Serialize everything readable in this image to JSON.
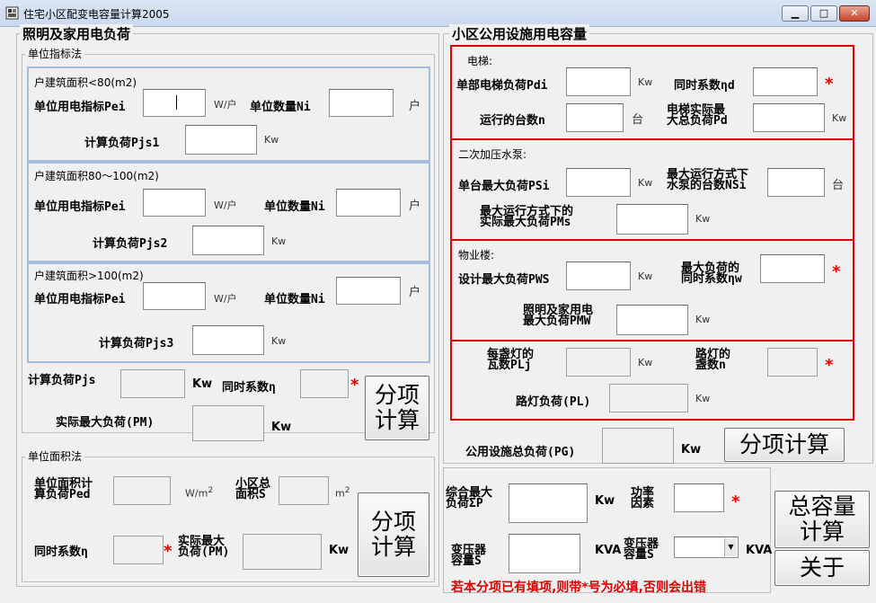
{
  "window": {
    "title": "住宅小区配变电容量计算2005",
    "min": "▁",
    "max": "□",
    "close": "✕"
  },
  "left": {
    "title": "照明及家用电负荷",
    "unit_index_method": {
      "legend": "单位指标法",
      "g1": {
        "legend": "户建筑面积<80(m2)",
        "pei_label": "单位用电指标Pei",
        "pei_unit": "W/户",
        "ni_label": "单位数量Ni",
        "ni_unit": "户",
        "pjs_label": "计算负荷Pjs1",
        "pjs_unit": "Kw"
      },
      "g2": {
        "legend": "户建筑面积80～100(m2)",
        "pei_label": "单位用电指标Pei",
        "pei_unit": "W/户",
        "ni_label": "单位数量Ni",
        "ni_unit": "户",
        "pjs_label": "计算负荷Pjs2",
        "pjs_unit": "Kw"
      },
      "g3": {
        "legend": "户建筑面积>100(m2)",
        "pei_label": "单位用电指标Pei",
        "pei_unit": "W/户",
        "ni_label": "单位数量Ni",
        "ni_unit": "户",
        "pjs_label": "计算负荷Pjs3",
        "pjs_unit": "Kw"
      },
      "total_pjs_label": "计算负荷Pjs",
      "total_pjs_unit": "Kw",
      "coef_label": "同时系数η",
      "star": "*",
      "pm_label": "实际最大负荷(PM)",
      "pm_unit": "Kw",
      "calc_button": [
        "分项",
        "计算"
      ]
    },
    "unit_area_method": {
      "legend": "单位面积法",
      "ped_label": [
        "单位面积计",
        "算负荷Ped"
      ],
      "ped_unit": "W/m",
      "sup2": "2",
      "s_label": [
        "小区总",
        "面积S"
      ],
      "s_unit": "m",
      "coef_label": "同时系数η",
      "star": "*",
      "pm_label": [
        "实际最大",
        "负荷(PM)"
      ],
      "pm_unit": "Kw",
      "calc_button": [
        "分项",
        "计算"
      ]
    }
  },
  "right": {
    "title": "小区公用设施用电容量",
    "elevator": {
      "legend": "电梯:",
      "pdi_label": "单部电梯负荷Pdi",
      "pdi_unit": "Kw",
      "coef_label": "同时系数ηd",
      "star": "*",
      "n_label": "运行的台数n",
      "n_unit": "台",
      "pd_label": [
        "电梯实际最",
        "大总负荷Pd"
      ],
      "pd_unit": "Kw"
    },
    "pump": {
      "legend": "二次加压水泵:",
      "psi_label": "单台最大负荷PSi",
      "psi_unit": "Kw",
      "nsi_label": [
        "最大运行方式下",
        "水泵的台数NSi"
      ],
      "nsi_unit": "台",
      "pms_label": [
        "最大运行方式下的",
        "实际最大负荷PMs"
      ],
      "pms_unit": "Kw"
    },
    "property": {
      "legend": "物业楼:",
      "pws_label": "设计最大负荷PWS",
      "pws_unit": "Kw",
      "coef_label": [
        "最大负荷的",
        "同时系数ηw"
      ],
      "star": "*",
      "pmw_label": [
        "照明及家用电",
        "最大负荷PMW"
      ],
      "pmw_unit": "Kw"
    },
    "streetlight": {
      "plj_label": [
        "每盏灯的",
        "瓦数PLj"
      ],
      "plj_unit": "Kw",
      "n_label": [
        "路灯的",
        "盏数n"
      ],
      "star": "*",
      "pl_label": "路灯负荷(PL)",
      "pl_unit": "Kw"
    },
    "pg_label": "公用设施总负荷(PG)",
    "pg_unit": "Kw",
    "calc_button": "分项计算"
  },
  "bottom": {
    "sum_label": [
      "综合最大",
      "负荷ΣP"
    ],
    "sum_unit": "Kw",
    "pf_label": [
      "功率",
      "因素"
    ],
    "star": "*",
    "cap_label": [
      "变压器",
      "容量S"
    ],
    "cap_unit": "KVA",
    "cap2_label": [
      "变压器",
      "容量S"
    ],
    "cap2_unit": "KVA",
    "total_button": [
      "总容量",
      "计算"
    ],
    "about_button": "关于",
    "warning": "若本分项已有填项,则带*号为必填,否则会出错"
  }
}
